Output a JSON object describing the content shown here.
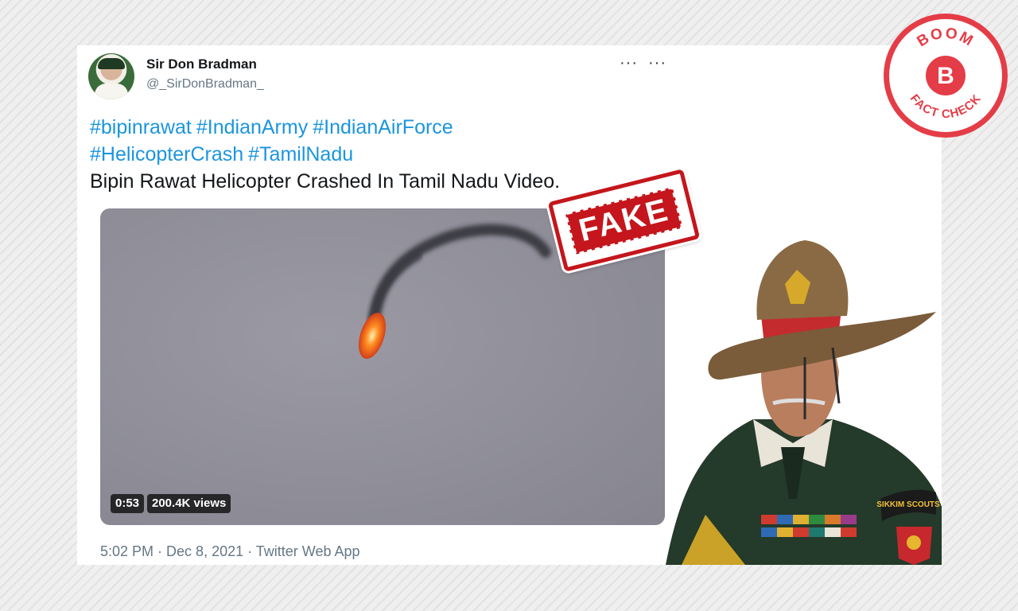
{
  "tweet": {
    "display_name": "Sir Don Bradman",
    "handle": "@_SirDonBradman_",
    "more_menu": "···",
    "hashtags_line1": [
      "#bipinrawat",
      "#IndianArmy",
      "#IndianAirForce"
    ],
    "hashtags_line2": [
      "#HelicopterCrash",
      "#TamilNadu"
    ],
    "text": "Bipin Rawat Helicopter Crashed In Tamil Nadu Video.",
    "video": {
      "duration": "0:53",
      "views": "200.4K views"
    },
    "time": "5:02 PM",
    "date": "Dec 8, 2021",
    "source": "Twitter Web App"
  },
  "stamp": {
    "label": "FAKE"
  },
  "brand": {
    "top": "BOOM",
    "letter": "B",
    "bottom": "FACT CHECK",
    "color": "#e43d47"
  },
  "general_insignia": {
    "shoulder_title": "SIKKIM SCOUTS"
  },
  "icons": [
    "more-icon",
    "fire-icon",
    "smoke-icon"
  ]
}
